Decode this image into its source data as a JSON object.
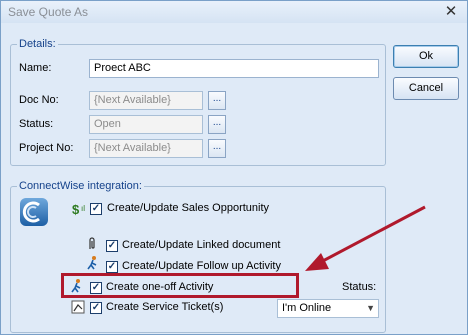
{
  "window": {
    "title": "Save Quote As",
    "close_glyph": "✕"
  },
  "details": {
    "legend": "Details:",
    "name_label": "Name:",
    "name_value": "Proect ABC",
    "docno_label": "Doc No:",
    "docno_value": "{Next Available}",
    "status_label": "Status:",
    "status_value": "Open",
    "projectno_label": "Project No:",
    "projectno_value": "{Next Available}",
    "browse_label": "..."
  },
  "buttons": {
    "ok": "Ok",
    "cancel": "Cancel"
  },
  "connectwise": {
    "legend": "ConnectWise integration:",
    "items": [
      {
        "label": "Create/Update Sales Opportunity",
        "checked": true
      },
      {
        "label": "Create/Update Linked document",
        "checked": true
      },
      {
        "label": "Create/Update Follow up Activity",
        "checked": true
      },
      {
        "label": "Create one-off Activity",
        "checked": true
      },
      {
        "label": "Create Service Ticket(s)",
        "checked": true
      }
    ],
    "status_label": "Status:",
    "status_value": "I'm Online"
  },
  "colors": {
    "highlight": "#b0192c",
    "arrow": "#b0192c",
    "accent": "#15428b"
  }
}
